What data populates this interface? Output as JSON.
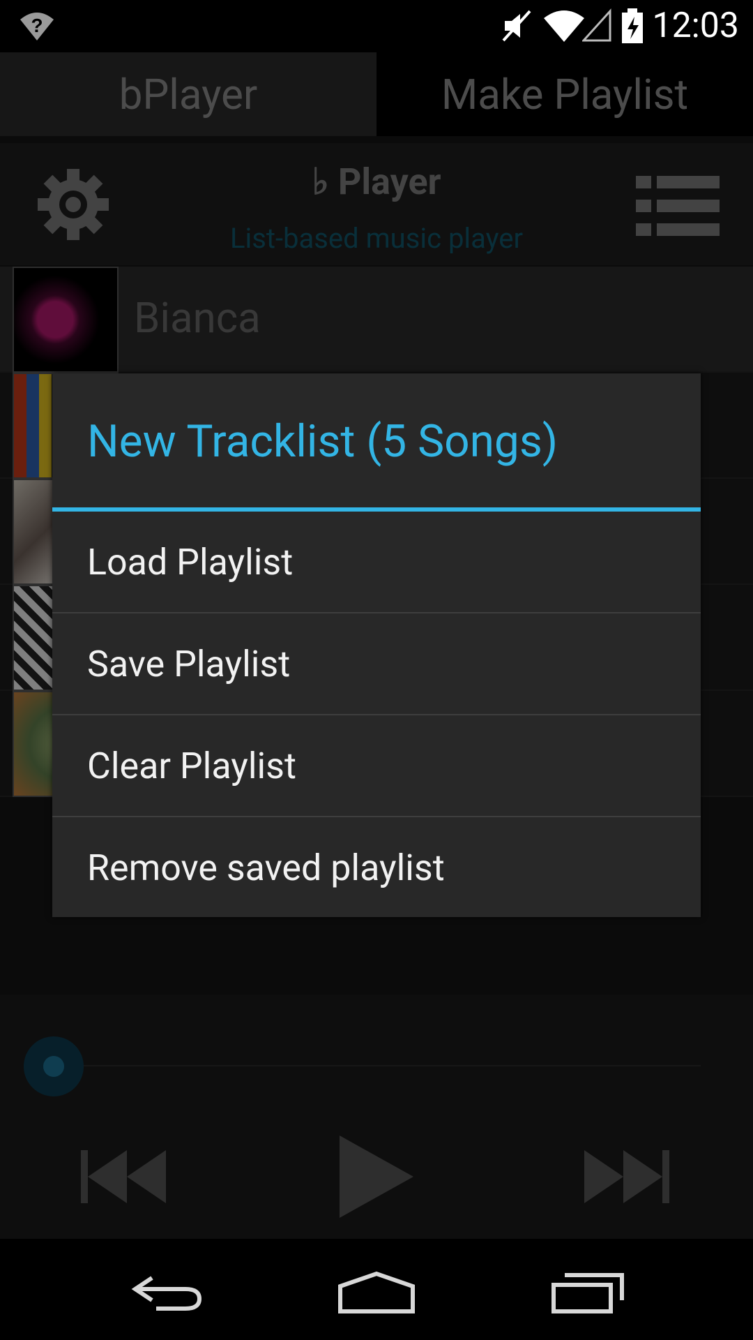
{
  "status_bar": {
    "time": "12:03"
  },
  "tabs": [
    {
      "label": "bPlayer"
    },
    {
      "label": "Make Playlist"
    }
  ],
  "header": {
    "title_glyph": "♭",
    "title": "Player",
    "subtitle": "List-based music player"
  },
  "tracks": [
    {
      "name": "Bianca"
    }
  ],
  "dialog": {
    "title": "New Tracklist (5 Songs)",
    "items": [
      {
        "label": "Load Playlist"
      },
      {
        "label": "Save Playlist"
      },
      {
        "label": "Clear Playlist"
      },
      {
        "label": "Remove saved playlist"
      }
    ]
  },
  "icons": {
    "settings": "gear-icon",
    "playlist": "list-icon",
    "previous": "skip-previous-icon",
    "play": "play-icon",
    "next": "skip-next-icon",
    "back": "back-icon",
    "home": "home-icon",
    "recents": "recent-apps-icon"
  },
  "colors": {
    "accent": "#33b5e5",
    "subtitle": "#11566b"
  }
}
